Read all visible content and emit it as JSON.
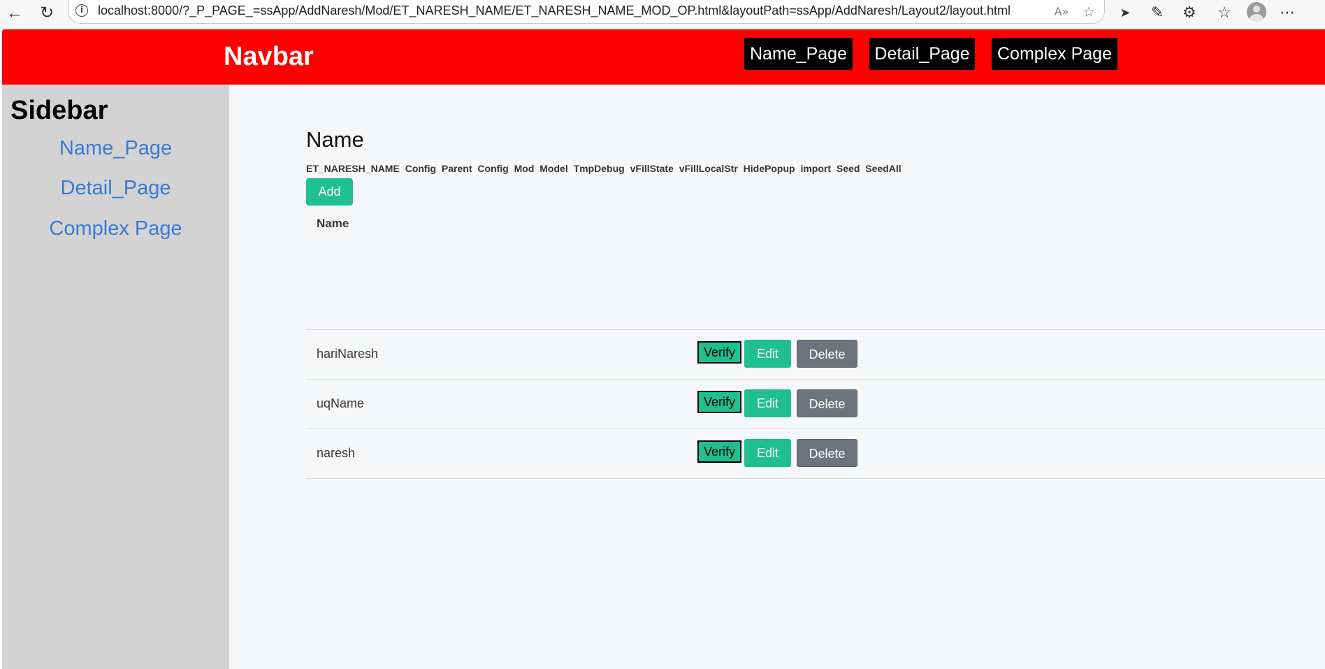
{
  "browser": {
    "url": "localhost:8000/?_P_PAGE_=ssApp/AddNaresh/Mod/ET_NARESH_NAME/ET_NARESH_NAME_MOD_OP.html&layoutPath=ssApp/AddNaresh/Layout2/layout.html",
    "back_icon": "←",
    "reload_icon": "↻",
    "info_icon": "i",
    "read_aloud_icon": "A»",
    "star_icon": "☆",
    "cursor_ext_icon": "➤",
    "eyedropper_icon": "✎",
    "extensions_icon": "⚙",
    "favorites_icon": "☆",
    "menu_icon": "⋯"
  },
  "navbar": {
    "brand": "Navbar",
    "links": [
      "Name_Page",
      "Detail_Page",
      "Complex Page"
    ]
  },
  "sidebar": {
    "title": "Sidebar",
    "links": [
      "Name_Page",
      "Detail_Page",
      "Complex Page"
    ]
  },
  "main": {
    "heading": "Name",
    "toolbar": [
      "ET_NARESH_NAME",
      "Config",
      "Parent",
      "Config",
      "Mod",
      "Model",
      "TmpDebug",
      "vFillState",
      "vFillLocalStr",
      "HidePopup",
      "import",
      "Seed",
      "SeedAll"
    ],
    "add_label": "Add",
    "table": {
      "header": "Name",
      "rows": [
        {
          "name": "hariNaresh",
          "verify": "Verify",
          "edit": "Edit",
          "delete": "Delete"
        },
        {
          "name": "uqName",
          "verify": "Verify",
          "edit": "Edit",
          "delete": "Delete"
        },
        {
          "name": "naresh",
          "verify": "Verify",
          "edit": "Edit",
          "delete": "Delete"
        }
      ]
    },
    "footer_text": "~"
  }
}
